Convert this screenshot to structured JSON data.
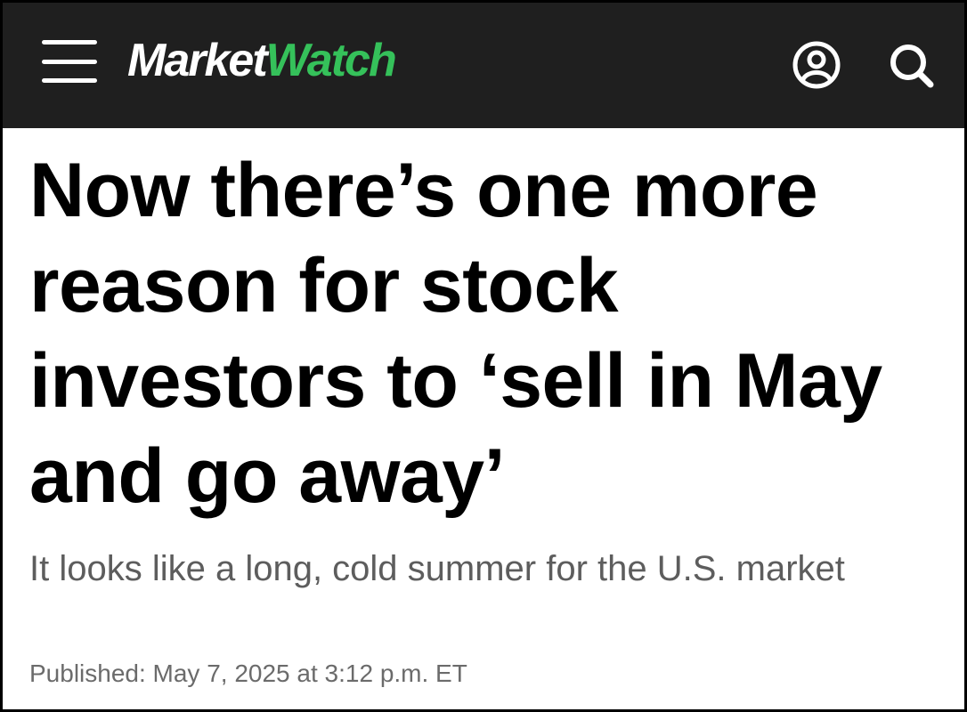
{
  "header": {
    "logo": {
      "part1": "Market",
      "part2": "Watch",
      "part1_color": "#ffffff",
      "part2_color": "#35c15a"
    },
    "menu_icon": "hamburger-menu-icon",
    "profile_icon": "user-profile-icon",
    "search_icon": "search-icon",
    "background_color": "#1f1f1f"
  },
  "article": {
    "headline": "Now there’s one more reason for stock investors to ‘sell in May and go away’",
    "subheadline": "It looks like a long, cold summer for the U.S. market",
    "published": "Published: May 7, 2025 at 3:12 p.m. ET"
  }
}
